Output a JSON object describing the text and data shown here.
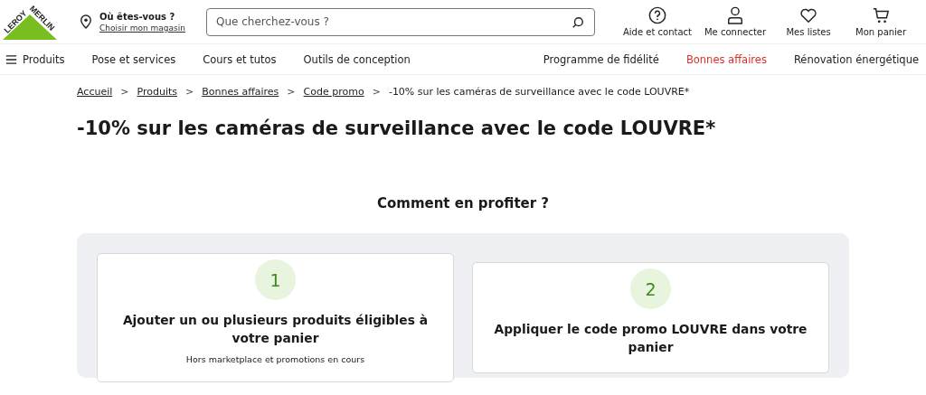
{
  "logo": {
    "line_1": "LEROY",
    "line_2": "MERLIN"
  },
  "store": {
    "title": "Où êtes-vous ?",
    "link": "Choisir mon magasin"
  },
  "search": {
    "placeholder": "Que cherchez-vous ?"
  },
  "header_actions": [
    {
      "kind": "help",
      "label": "Aide et contact"
    },
    {
      "kind": "account",
      "label": "Me connecter"
    },
    {
      "kind": "lists",
      "label": "Mes listes"
    },
    {
      "kind": "cart",
      "label": "Mon panier"
    }
  ],
  "nav_left": [
    {
      "label": "Produits",
      "menu": true,
      "highlighted": false
    },
    {
      "label": "Pose et services",
      "menu": false,
      "highlighted": false
    },
    {
      "label": "Cours et tutos",
      "menu": false,
      "highlighted": false
    },
    {
      "label": "Outils de conception",
      "menu": false,
      "highlighted": false
    }
  ],
  "nav_right": [
    {
      "label": "Programme de fidélité",
      "highlighted": false
    },
    {
      "label": "Bonnes affaires",
      "highlighted": true
    },
    {
      "label": "Rénovation énergétique",
      "highlighted": false
    }
  ],
  "breadcrumb": {
    "links": [
      "Accueil",
      "Produits",
      "Bonnes affaires",
      "Code promo"
    ],
    "separator": ">",
    "current": "-10% sur les caméras de surveillance avec le code LOUVRE*"
  },
  "page_title": "-10% sur les caméras de surveillance avec le code LOUVRE*",
  "section_title": "Comment en profiter ?",
  "steps": [
    {
      "number": "1",
      "title": "Ajouter un ou plusieurs produits éligibles à votre panier",
      "note": "Hors marketplace et promotions en cours"
    },
    {
      "number": "2",
      "title": "Appliquer le code promo LOUVRE dans votre panier"
    }
  ]
}
